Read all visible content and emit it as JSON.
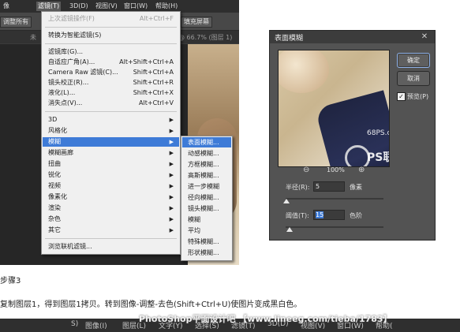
{
  "menubar": {
    "items": [
      "像",
      "滤镜(T)",
      "3D(D)",
      "视图(V)",
      "窗口(W)",
      "帮助(H)"
    ],
    "active_index": 1
  },
  "options_bar": {
    "btn1": "调整所有",
    "btn2": "填充屏幕",
    "tab_text_left": "未",
    "tab_text_right": "@ 66.7% (图层 1)"
  },
  "filter_menu": {
    "items": [
      {
        "label": "上次滤镜操作(F)",
        "shortcut": "Alt+Ctrl+F",
        "disabled": true
      },
      {
        "label": "转换为智能滤镜(S)"
      },
      {
        "label": "滤镜库(G)..."
      },
      {
        "label": "自适应广角(A)...",
        "shortcut": "Alt+Shift+Ctrl+A"
      },
      {
        "label": "Camera Raw 滤镜(C)...",
        "shortcut": "Shift+Ctrl+A"
      },
      {
        "label": "镜头校正(R)...",
        "shortcut": "Shift+Ctrl+R"
      },
      {
        "label": "液化(L)...",
        "shortcut": "Shift+Ctrl+X"
      },
      {
        "label": "消失点(V)...",
        "shortcut": "Alt+Ctrl+V"
      },
      {
        "label": "3D",
        "submenu": true
      },
      {
        "label": "风格化",
        "submenu": true
      },
      {
        "label": "模糊",
        "submenu": true,
        "highlighted": true
      },
      {
        "label": "模糊画廊",
        "submenu": true
      },
      {
        "label": "扭曲",
        "submenu": true
      },
      {
        "label": "锐化",
        "submenu": true
      },
      {
        "label": "视频",
        "submenu": true
      },
      {
        "label": "像素化",
        "submenu": true
      },
      {
        "label": "渲染",
        "submenu": true
      },
      {
        "label": "杂色",
        "submenu": true
      },
      {
        "label": "其它",
        "submenu": true
      },
      {
        "label": "浏览联机滤镜..."
      }
    ]
  },
  "blur_submenu": {
    "items": [
      "表面模糊...",
      "动感模糊...",
      "方框模糊...",
      "高斯模糊...",
      "进一步模糊",
      "径向模糊...",
      "镜头模糊...",
      "模糊",
      "平均",
      "特殊模糊...",
      "形状模糊..."
    ],
    "highlighted_index": 0
  },
  "dialog": {
    "title": "表面模糊",
    "close": "✕",
    "ok": "确定",
    "cancel": "取消",
    "preview_label": "预览(P)",
    "preview_checked": true,
    "zoom": "100%",
    "radius_label": "半径(R):",
    "radius_value": "5",
    "radius_unit": "像素",
    "threshold_label": "阈值(T):",
    "threshold_value": "15",
    "threshold_unit": "色阶",
    "watermark_site": "68PS.com",
    "watermark_brand": "PS联盟"
  },
  "page": {
    "step": "步骤3",
    "description": "复制图层1，得到图层1拷贝。转到图像-调整-去色(Shift+Ctrl+U)使图片变成黑白色。",
    "watermark_line": "PhotoShop平面设计吧 【www.lineeg.com/tieba/1783】",
    "bottom_menu": [
      "S)",
      "图像(I)",
      "图层(L)",
      "文字(Y)",
      "选择(S)",
      "滤镜(T)",
      "3D(D)",
      "视图(V)",
      "窗口(W)",
      "帮助("
    ]
  }
}
